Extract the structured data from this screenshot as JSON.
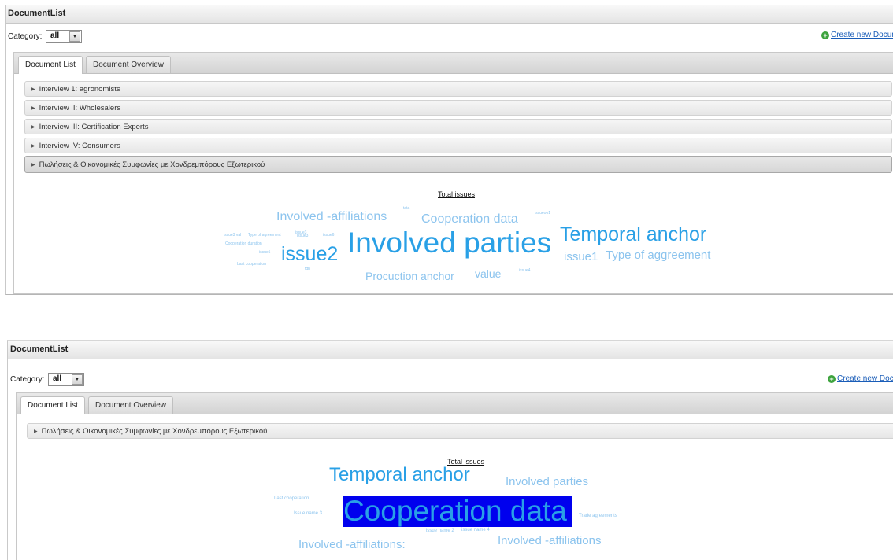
{
  "panel1": {
    "title": "DocumentList",
    "category_label": "Category:",
    "category_value": "all",
    "create_label": "Create new Documer",
    "tabs": [
      "Document List",
      "Document Overview"
    ],
    "items": [
      "Interview 1: agronomists",
      "Interview II: Wholesalers",
      "Interview III: Certification Experts",
      "Interview IV: Consumers",
      "Πωλήσεις & Οικονομικές Συμφωνίες με Χονδρεμπόρους Εξωτερικού"
    ],
    "cloud_title": "Total issues",
    "cloud_words": [
      "Involved -affiliations",
      "Cooperation data",
      "Involved parties",
      "Temporal anchor",
      "issue2",
      "issue1",
      "Type of aggreement",
      "Procuction anchor",
      "value",
      "tata",
      "issueoo1",
      "issue3 val",
      "Type of agreement",
      "issue3",
      "issue3",
      "issue6",
      "Cooperation duration",
      "issue5",
      "Last cooperation",
      "fdh",
      "issue4"
    ]
  },
  "panel2": {
    "title": "DocumentList",
    "category_label": "Category:",
    "category_value": "all",
    "create_label": "Create new Docum",
    "tabs": [
      "Document List",
      "Document Overview"
    ],
    "items": [
      "Πωλήσεις & Οικονομικές Συμφωνίες με Χονδρεμπόρους Εξωτερικού"
    ],
    "cloud_title": "Total issues",
    "cloud_words": [
      "Temporal anchor",
      "Involved parties",
      "Last cooperation",
      "Issue name 3",
      "Cooperation data",
      "Trade agreements",
      "issue name 2",
      "issue name 4",
      "Involved -affiliations",
      "Involved -affiliations:"
    ]
  },
  "colors": {
    "cloud_dark": "#29a0e6",
    "cloud_light": "#8cc4ee",
    "highlight": "#0000ee"
  },
  "icons": {
    "expand": "triangle-right-icon",
    "dropdown": "chevron-down-icon",
    "create": "plus-circle-icon"
  }
}
